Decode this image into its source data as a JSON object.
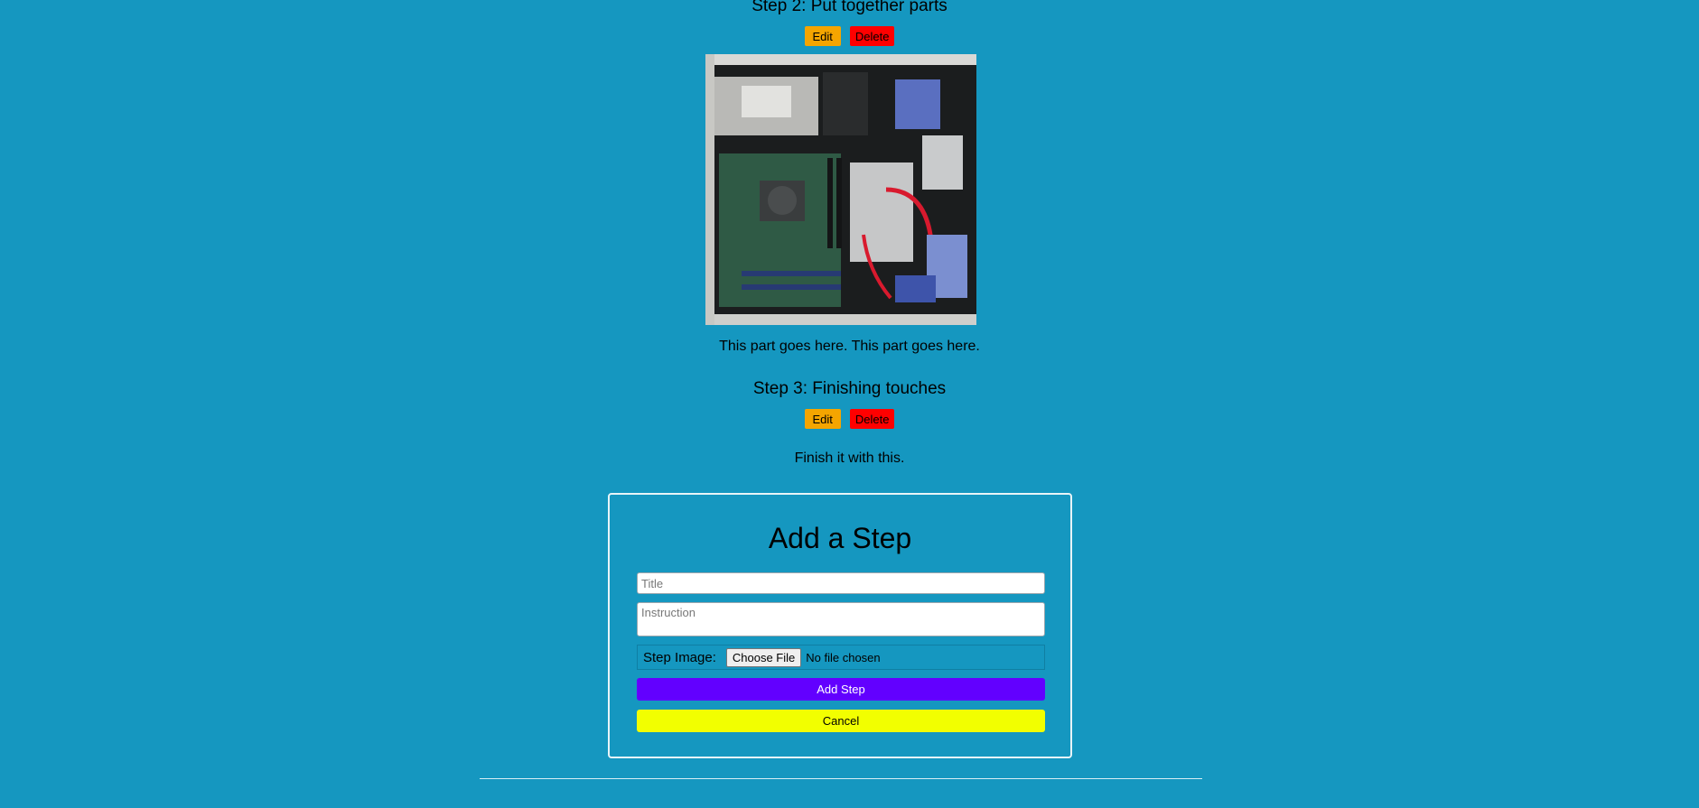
{
  "steps": [
    {
      "title": "Step 2: Put together parts",
      "edit_label": "Edit",
      "delete_label": "Delete",
      "image_icon": "pc-internals-photo",
      "text": "This part goes here. This part goes here."
    },
    {
      "title": "Step 3: Finishing touches",
      "edit_label": "Edit",
      "delete_label": "Delete",
      "text": "Finish it with this."
    }
  ],
  "form": {
    "title": "Add a Step",
    "title_placeholder": "Title",
    "instruction_placeholder": "Instruction",
    "image_label": "Step Image:",
    "file_button_label": "Choose File",
    "file_status": "No file chosen",
    "add_label": "Add Step",
    "cancel_label": "Cancel"
  },
  "colors": {
    "background": "#1597c0",
    "edit": "#f5a500",
    "delete": "#ff0000",
    "add": "#6200ff",
    "cancel": "#f2ff00"
  }
}
